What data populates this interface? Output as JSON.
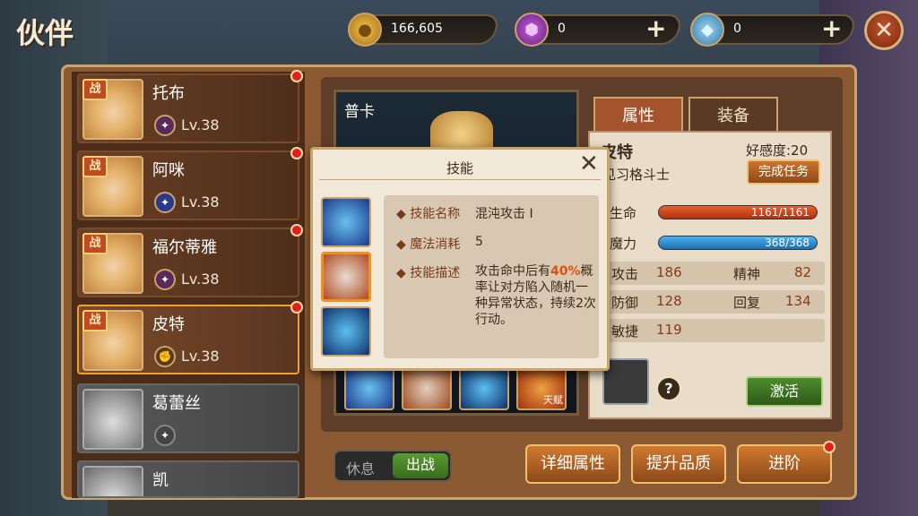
{
  "screen": {
    "title": "伙伴"
  },
  "resources": [
    {
      "name": "gold-coin-icon",
      "glyph": "●",
      "value": "166,605"
    },
    {
      "name": "purple-gem-icon",
      "glyph": "⬢",
      "value": "0"
    },
    {
      "name": "diamond-icon",
      "glyph": "◆",
      "value": "0"
    }
  ],
  "resource_plus": "+",
  "close_glyph": "✕",
  "roster": [
    {
      "name": "托布",
      "badge": "战",
      "level": "Lv.38",
      "dot": true
    },
    {
      "name": "阿咪",
      "badge": "战",
      "level": "Lv.38",
      "dot": true
    },
    {
      "name": "福尔蒂雅",
      "badge": "战",
      "level": "Lv.38",
      "dot": true
    },
    {
      "name": "皮特",
      "badge": "战",
      "level": "Lv.38",
      "dot": true,
      "selected": true
    },
    {
      "name": "葛蕾丝",
      "badge": "",
      "level": "",
      "locked": true
    },
    {
      "name": "凯",
      "badge": "",
      "level": "",
      "locked": true
    }
  ],
  "portrait": {
    "name": "普卡"
  },
  "tabs": {
    "attributes": "属性",
    "equipment": "装备"
  },
  "hero": {
    "name": "皮特",
    "class": "见习格斗士",
    "favor": "好感度:20",
    "task_button": "完成任务",
    "hp_label": "生命",
    "hp": "1161/1161",
    "mp_label": "魔力",
    "mp": "368/368",
    "stats": {
      "atk_label": "攻击",
      "atk": "186",
      "spirit_label": "精神",
      "spirit": "82",
      "def_label": "防御",
      "def": "128",
      "recover_label": "回复",
      "recover": "134",
      "agi_label": "敏捷",
      "agi": "119"
    },
    "help": "?",
    "activate_button": "激活"
  },
  "bottom_skill_tag": "天赋",
  "toggle": {
    "rest": "休息",
    "battle": "出战"
  },
  "buttons": {
    "details": "详细属性",
    "upgrade": "提升品质",
    "advance": "进阶"
  },
  "skill_popup": {
    "title": "技能",
    "close": "✕",
    "name_label": "技能名称",
    "name": "混沌攻击 I",
    "cost_label": "魔法消耗",
    "cost": "5",
    "desc_label": "技能描述",
    "desc_pre": "攻击命中后有",
    "desc_pct": "40%",
    "desc_post": "概率让对方陷入随机一种异常状态，持续2次行动。"
  },
  "colors": {
    "hp_bar": "#d04a1e",
    "mp_bar": "#2a8ed0",
    "accent": "#caa36a"
  }
}
